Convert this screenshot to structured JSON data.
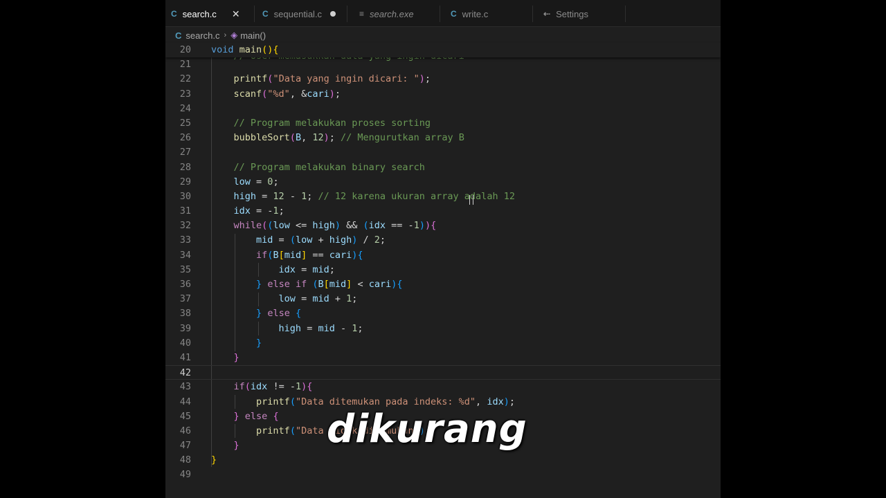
{
  "tabs": [
    {
      "label": "search.c",
      "icon": "C",
      "active": true
    },
    {
      "label": "sequential.c",
      "icon": "C",
      "modified": true
    },
    {
      "label": "search.exe",
      "icon": "≡"
    },
    {
      "label": "write.c",
      "icon": "C"
    },
    {
      "label": "Settings",
      "icon": "⇠"
    }
  ],
  "breadcrumb": {
    "file": "search.c",
    "symbol": "main()"
  },
  "lines": [
    {
      "n": "20",
      "code": "<span class=\"kw\">void</span> <span class=\"fn\">main</span><span class=\"b1\">(){</span>"
    },
    {
      "n": "21",
      "code": "    <span class=\"cm\">// User memasukkan data yang ingin dicari</span>"
    },
    {
      "n": "22",
      "code": "    <span class=\"fn\">printf</span><span class=\"b2\">(</span><span class=\"str\">\"Data yang ingin dicari: \"</span><span class=\"b2\">)</span>;"
    },
    {
      "n": "23",
      "code": "    <span class=\"fn\">scanf</span><span class=\"b2\">(</span><span class=\"str\">\"%d\"</span>, &amp;<span class=\"var\">cari</span><span class=\"b2\">)</span>;"
    },
    {
      "n": "24",
      "code": ""
    },
    {
      "n": "25",
      "code": "    <span class=\"cm\">// Program melakukan proses sorting</span>"
    },
    {
      "n": "26",
      "code": "    <span class=\"fn\">bubbleSort</span><span class=\"b2\">(</span><span class=\"var\">B</span>, <span class=\"num\">12</span><span class=\"b2\">)</span>; <span class=\"cm\">// Mengurutkan array B</span>"
    },
    {
      "n": "27",
      "code": ""
    },
    {
      "n": "28",
      "code": "    <span class=\"cm\">// Program melakukan binary search</span>"
    },
    {
      "n": "29",
      "code": "    <span class=\"var\">low</span> = <span class=\"num\">0</span>;"
    },
    {
      "n": "30",
      "code": "    <span class=\"var\">high</span> = <span class=\"num\">12</span> - <span class=\"num\">1</span>; <span class=\"cm\">// 12 karena ukuran array adalah 12</span>"
    },
    {
      "n": "31",
      "code": "    <span class=\"var\">idx</span> = -<span class=\"num\">1</span>;"
    },
    {
      "n": "32",
      "code": "    <span class=\"ctl\">while</span><span class=\"b2\">(</span><span class=\"b3\">(</span><span class=\"var\">low</span> &lt;= <span class=\"var\">high</span><span class=\"b3\">)</span> &amp;&amp; <span class=\"b3\">(</span><span class=\"var\">idx</span> == -<span class=\"num\">1</span><span class=\"b3\">)</span><span class=\"b2\">){</span>"
    },
    {
      "n": "33",
      "code": "        <span class=\"var\">mid</span> = <span class=\"b3\">(</span><span class=\"var\">low</span> + <span class=\"var\">high</span><span class=\"b3\">)</span> / <span class=\"num\">2</span>;"
    },
    {
      "n": "34",
      "code": "        <span class=\"ctl\">if</span><span class=\"b3\">(</span><span class=\"var\">B</span><span class=\"b1\">[</span><span class=\"var\">mid</span><span class=\"b1\">]</span> == <span class=\"var\">cari</span><span class=\"b3\">){</span>"
    },
    {
      "n": "35",
      "code": "            <span class=\"var\">idx</span> = <span class=\"var\">mid</span>;"
    },
    {
      "n": "36",
      "code": "        <span class=\"b3\">}</span> <span class=\"ctl\">else if</span> <span class=\"b3\">(</span><span class=\"var\">B</span><span class=\"b1\">[</span><span class=\"var\">mid</span><span class=\"b1\">]</span> &lt; <span class=\"var\">cari</span><span class=\"b3\">){</span>"
    },
    {
      "n": "37",
      "code": "            <span class=\"var\">low</span> = <span class=\"var\">mid</span> + <span class=\"num\">1</span>;"
    },
    {
      "n": "38",
      "code": "        <span class=\"b3\">}</span> <span class=\"ctl\">else</span> <span class=\"b3\">{</span>"
    },
    {
      "n": "39",
      "code": "            <span class=\"var\">high</span> = <span class=\"var\">mid</span> - <span class=\"num\">1</span>;"
    },
    {
      "n": "40",
      "code": "        <span class=\"b3\">}</span>"
    },
    {
      "n": "41",
      "code": "    <span class=\"b2\">}</span>"
    },
    {
      "n": "42",
      "code": ""
    },
    {
      "n": "43",
      "code": "    <span class=\"ctl\">if</span><span class=\"b2\">(</span><span class=\"var\">idx</span> != -<span class=\"num\">1</span><span class=\"b2\">){</span>"
    },
    {
      "n": "44",
      "code": "        <span class=\"fn\">printf</span><span class=\"b3\">(</span><span class=\"str\">\"Data ditemukan pada indeks: %d\"</span>, <span class=\"var\">idx</span><span class=\"b3\">)</span>;"
    },
    {
      "n": "45",
      "code": "    <span class=\"b2\">}</span> <span class=\"ctl\">else</span> <span class=\"b2\">{</span>"
    },
    {
      "n": "46",
      "code": "        <span class=\"fn\">printf</span><span class=\"b3\">(</span><span class=\"str\">\"Data tidak ditemukan\"</span><span class=\"b3\">)</span>;"
    },
    {
      "n": "47",
      "code": "    <span class=\"b2\">}</span>"
    },
    {
      "n": "48",
      "code": "<span class=\"b1\">}</span>"
    },
    {
      "n": "49",
      "code": ""
    }
  ],
  "current_line": "42",
  "caption": "dikurang"
}
